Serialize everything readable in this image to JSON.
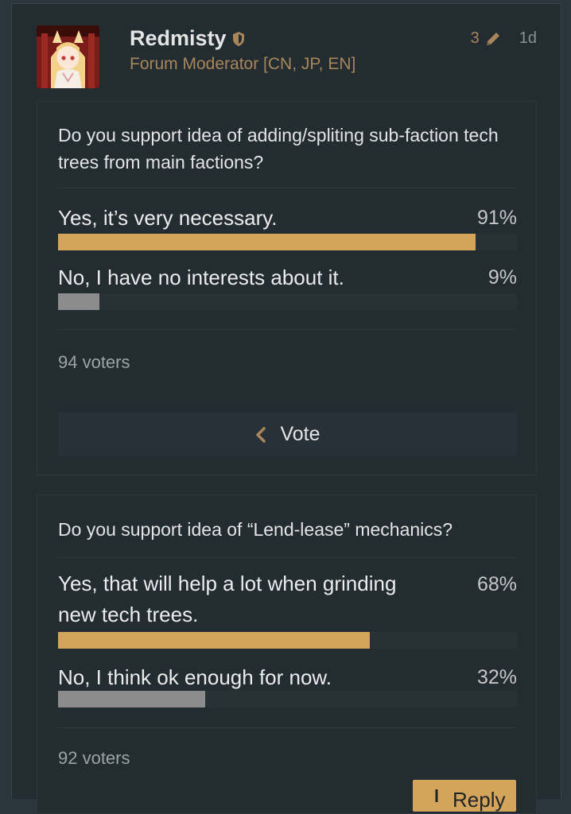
{
  "post": {
    "username": "Redmisty",
    "user_title": "Forum Moderator [CN, JP, EN]",
    "edit_count": "3",
    "date": "1d"
  },
  "polls": [
    {
      "question": "Do you support idea of adding/spliting sub-faction tech trees from main factions?",
      "options": [
        {
          "label": "Yes, it’s very necessary.",
          "pct": "91%",
          "value": 0.91
        },
        {
          "label": "No, I have no interests about it.",
          "pct": "9%",
          "value": 0.09
        }
      ],
      "voters": "94 voters",
      "button": "Vote"
    },
    {
      "question": "Do you support idea of “Lend-lease” mechanics?",
      "options": [
        {
          "label": "Yes, that will help a lot when grinding new tech trees.",
          "pct": "68%",
          "value": 0.68
        },
        {
          "label": "No, I think ok enough for now.",
          "pct": "32%",
          "value": 0.32
        }
      ],
      "voters": "92 voters",
      "button": "Reply"
    }
  ],
  "colors": {
    "winning_bar": "#d4a45a",
    "losing_bar": "#8c8c8c",
    "accent": "#a9865a"
  },
  "icons": [
    "moderator-shield-icon",
    "pencil-icon",
    "chevron-left-icon",
    "reply-arrow-icon"
  ]
}
